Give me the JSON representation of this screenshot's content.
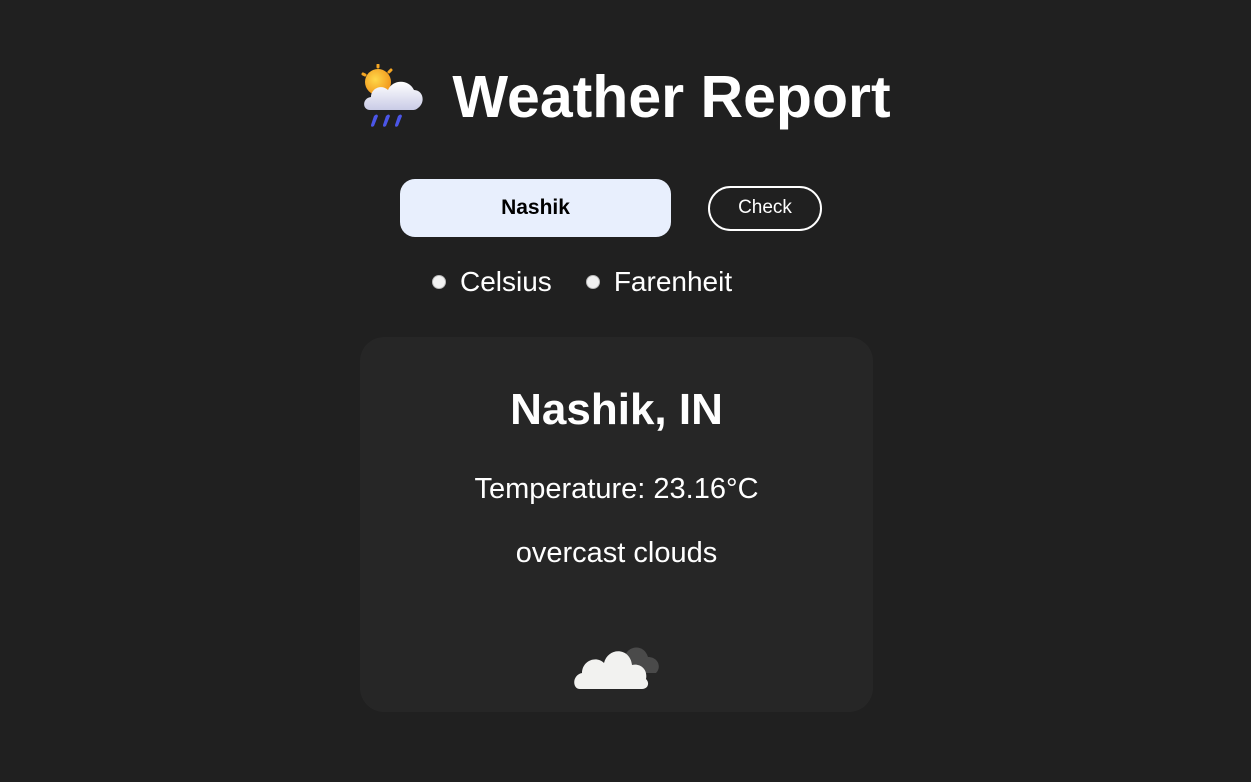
{
  "header": {
    "title": "Weather Report",
    "logo_icon": "sun-behind-rain-cloud-icon"
  },
  "search": {
    "value": "Nashik",
    "check_label": "Check"
  },
  "units": {
    "options": [
      {
        "label": "Celsius"
      },
      {
        "label": "Farenheit"
      }
    ]
  },
  "weather": {
    "location": "Nashik, IN",
    "temperature": "Temperature: 23.16°C",
    "description": "overcast clouds",
    "icon": "overcast-clouds-icon"
  },
  "colors": {
    "background": "#202020",
    "card": "#262626",
    "input": "#e8effd",
    "text": "#ffffff"
  }
}
